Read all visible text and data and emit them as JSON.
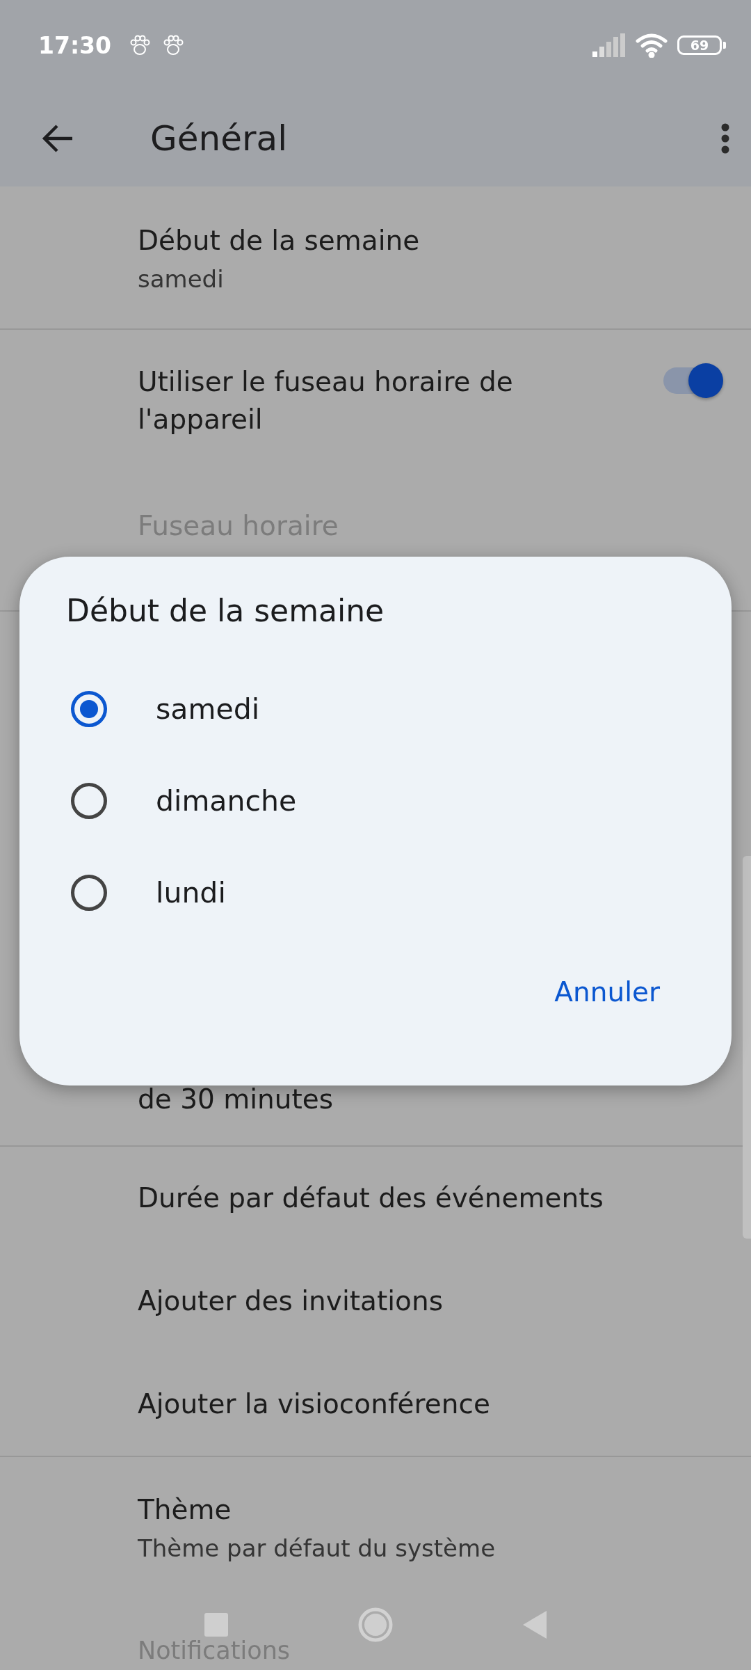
{
  "status_bar": {
    "time": "17:30",
    "battery": "69"
  },
  "app_bar": {
    "title": "Général"
  },
  "sections": [
    [
      {
        "kind": "text",
        "title": "Début de la semaine",
        "subtitle": "samedi",
        "disabled": false
      }
    ],
    [
      {
        "kind": "toggle",
        "title": "Utiliser le fuseau horaire de l'appareil",
        "on": true,
        "disabled": false
      },
      {
        "kind": "text",
        "title": "Fuseau horaire",
        "disabled": true
      }
    ],
    [
      {
        "kind": "partial",
        "subtitle": "de 30 minutes",
        "disabled": false
      }
    ],
    [
      {
        "kind": "text",
        "title": "Durée par défaut des événements",
        "disabled": false
      },
      {
        "kind": "text",
        "title": "Ajouter des invitations",
        "disabled": false
      },
      {
        "kind": "text",
        "title": "Ajouter la visioconférence",
        "disabled": false
      }
    ],
    [
      {
        "kind": "text",
        "title": "Thème",
        "subtitle": "Thème par défaut du système",
        "disabled": false
      },
      {
        "kind": "text",
        "title": "Notifications",
        "disabled": true
      }
    ]
  ],
  "dialog": {
    "title": "Début de la semaine",
    "options": [
      {
        "label": "samedi",
        "selected": true
      },
      {
        "label": "dimanche",
        "selected": false
      },
      {
        "label": "lundi",
        "selected": false
      }
    ],
    "buttons": [
      "Annuler"
    ]
  }
}
